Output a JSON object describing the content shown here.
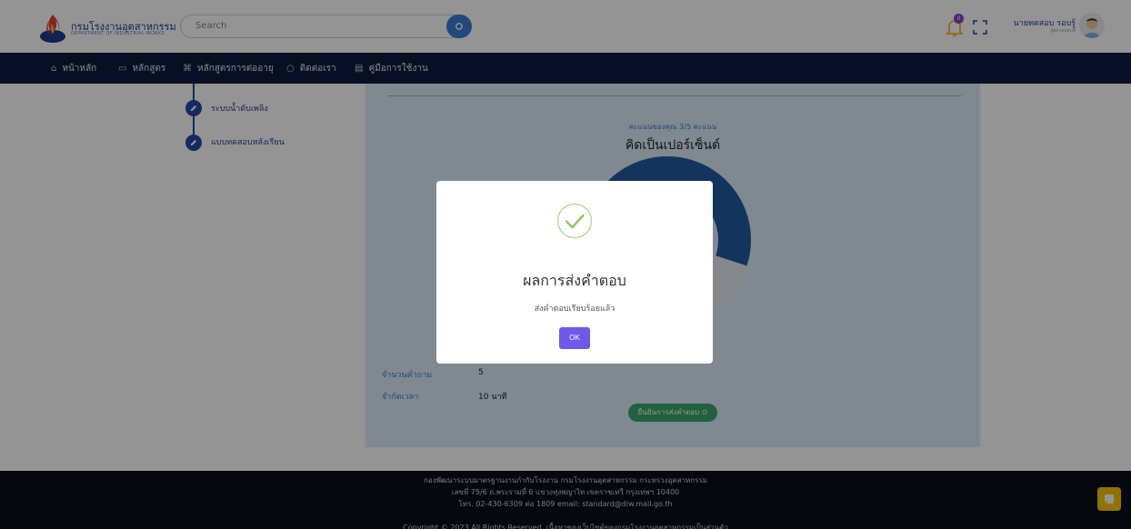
{
  "header": {
    "logo_title": "กรมโรงงานอุตสาหกรรม",
    "logo_subtitle": "DEPARTMENT OF INDUSTRIAL WORKS",
    "search_placeholder": "Search",
    "notification_count": "0",
    "user_name": "นายทดสอบ รอบรู้",
    "user_role": "ผู้ตรวจสอบที่"
  },
  "nav": {
    "items": [
      {
        "icon": "home-icon",
        "label": "หน้าหลัก"
      },
      {
        "icon": "monitor-icon",
        "label": "หลักสูตร"
      },
      {
        "icon": "command-icon",
        "label": "หลักสูตรการต่ออายุ"
      },
      {
        "icon": "chat-icon",
        "label": "ติดต่อเรา"
      },
      {
        "icon": "book-icon",
        "label": "คู่มือการใช้งาน"
      }
    ]
  },
  "sidebar": {
    "steps": [
      {
        "label": "ระบบน้ำดับเพลิง"
      },
      {
        "label": "แบบทดสอบหลังเรียน"
      }
    ]
  },
  "result": {
    "score_label": "คะแนนของคุณ 3/5 คะแนน",
    "title": "คิดเป็นเปอร์เซ็นต์",
    "score": 3,
    "total": 5,
    "question_count_label": "จำนวนคำถาม",
    "question_count_value": "5",
    "time_limit_label": "จำกัดเวลา",
    "time_limit_value": "10 นาที",
    "submit_label": "ยืนยันการส่งคำตอบ",
    "colors": {
      "filled": "#1f5aa0",
      "empty": "#e6e9ee"
    }
  },
  "footer": {
    "line1": "กองพัฒนาระบบมาตรฐานงานกำกับโรงงาน กรมโรงงานอุตสาหกรรม กระทรวงอุตสาหกรรม",
    "line2": "เลขที่ 75/6 ถ.พระรามที่ 6 แขวงทุ่งพญาไท เขตราชเทวี กรุงเทพฯ 10400",
    "line3": "โทร. 02-430-6309 ต่อ 1809 email: standard@diw.mail.go.th",
    "line4": "Copyright © 2023 All Rights Reserved. เนื้อหาของเว็บไซต์ของกรมโรงงานอุตสาหกรรมเป็นส่วนตัว"
  },
  "modal": {
    "title": "ผลการส่งคำตอบ",
    "message": "ส่งคำตอบเรียบร้อยแล้ว",
    "ok_label": "OK"
  }
}
